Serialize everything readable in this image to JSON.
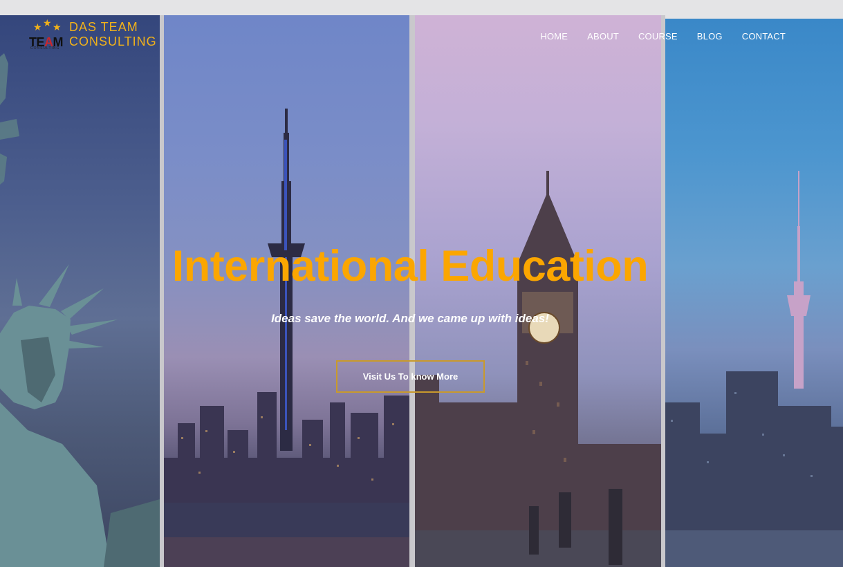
{
  "logo": {
    "mark_text_pre": "TE",
    "mark_text_accent": "A",
    "mark_text_post": "M",
    "mark_subtext": "CONSULTING",
    "line1": "DAS TEAM",
    "line2": "CONSULTING"
  },
  "nav": {
    "items": [
      {
        "label": "HOME"
      },
      {
        "label": "ABOUT"
      },
      {
        "label": "COURSE"
      },
      {
        "label": "BLOG"
      },
      {
        "label": "CONTACT"
      }
    ]
  },
  "hero": {
    "title": "International Education",
    "subtitle": "Ideas save the world. And we came up with ideas!",
    "button_label": "Visit Us To know More"
  },
  "colors": {
    "accent": "#fba600",
    "button_border": "#c99a2c",
    "text": "#ffffff"
  }
}
